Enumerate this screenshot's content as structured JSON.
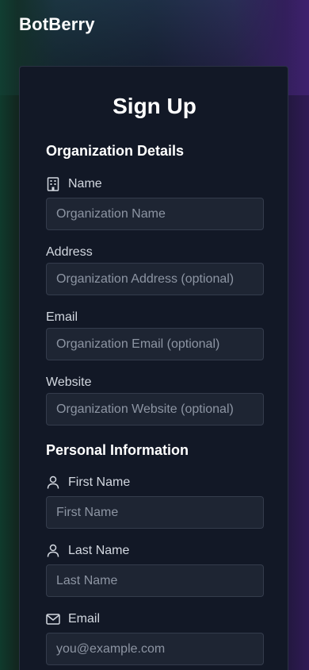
{
  "app": {
    "brand": "BotBerry"
  },
  "form": {
    "title": "Sign Up",
    "organization_section": {
      "heading": "Organization Details",
      "name": {
        "label": "Name",
        "placeholder": "Organization Name",
        "icon": "building-icon"
      },
      "address": {
        "label": "Address",
        "placeholder": "Organization Address (optional)"
      },
      "email": {
        "label": "Email",
        "placeholder": "Organization Email (optional)"
      },
      "website": {
        "label": "Website",
        "placeholder": "Organization Website (optional)"
      }
    },
    "personal_section": {
      "heading": "Personal Information",
      "first_name": {
        "label": "First Name",
        "placeholder": "First Name",
        "icon": "user-icon"
      },
      "last_name": {
        "label": "Last Name",
        "placeholder": "Last Name",
        "icon": "user-icon"
      },
      "email": {
        "label": "Email",
        "placeholder": "you@example.com",
        "icon": "mail-icon"
      }
    }
  },
  "colors": {
    "background": "#111722",
    "card": "#121826",
    "input_background": "#1e2533",
    "input_border": "#343c4c",
    "text": "#ffffff",
    "label": "#d3d8e0",
    "placeholder": "#8d95a3"
  }
}
